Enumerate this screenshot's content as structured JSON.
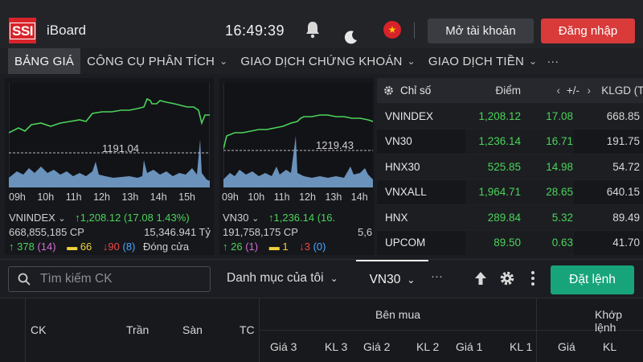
{
  "header": {
    "logo_text": "SSI",
    "app_name": "iBoard",
    "clock": "16:49:39",
    "open_account": "Mở tài khoản",
    "login": "Đăng nhập",
    "flag_symbol": "★"
  },
  "menu": {
    "items": [
      {
        "label": "BẢNG GIÁ",
        "chevron": ""
      },
      {
        "label": "CÔNG CỤ PHÂN TÍCH",
        "chevron": "⌄"
      },
      {
        "label": "GIAO DỊCH CHỨNG KHOÁN",
        "chevron": "⌄"
      },
      {
        "label": "GIAO DỊCH TIỀN",
        "chevron": "⌄"
      }
    ],
    "more": "···"
  },
  "charts": [
    {
      "ref_label": "1191.04",
      "times": [
        "09h",
        "10h",
        "11h",
        "12h",
        "13h",
        "14h",
        "15h"
      ],
      "name": "VNINDEX",
      "chevron": "⌄",
      "value_line": "↑1,208.12 (17.08 1.43%)",
      "volume": "668,855,185 CP",
      "value_total": "15,346.941 Tỷ",
      "up": "↑ 378",
      "ceil": "(14)",
      "ref": "66",
      "down": "↓90",
      "floor": "(8)",
      "status": "Đóng cửa"
    },
    {
      "ref_label": "1219.43",
      "times": [
        "09h",
        "10h",
        "11h",
        "12h",
        "13h",
        "14h"
      ],
      "name": "VN30",
      "chevron": "⌄",
      "value_line": "↑1,236.14 (16.",
      "volume": "191,758,175 CP",
      "value_total": "5,6",
      "up": "↑ 26",
      "ceil": "(1)",
      "ref": "1",
      "down": "↓3",
      "floor": "(0)",
      "status": ""
    }
  ],
  "index_table": {
    "headers": {
      "name": "Chỉ số",
      "point": "Điểm",
      "change": "+/-",
      "volume": "KLGD (Triệu)"
    },
    "rows": [
      {
        "name": "VNINDEX",
        "point": "1,208.12",
        "change": "17.08",
        "volume": "668.85"
      },
      {
        "name": "VN30",
        "point": "1,236.14",
        "change": "16.71",
        "volume": "191.75"
      },
      {
        "name": "HNX30",
        "point": "525.85",
        "change": "14.98",
        "volume": "54.72"
      },
      {
        "name": "VNXALL",
        "point": "1,964.71",
        "change": "28.65",
        "volume": "640.15"
      },
      {
        "name": "HNX",
        "point": "289.84",
        "change": "5.32",
        "volume": "89.49"
      },
      {
        "name": "UPCOM",
        "point": "89.50",
        "change": "0.63",
        "volume": "41.70"
      }
    ]
  },
  "filter": {
    "search_placeholder": "Tìm kiếm CK",
    "watchlist": "Danh mục của tôi",
    "selected_group": "VN30",
    "more": "···",
    "order_button": "Đặt lệnh"
  },
  "board": {
    "ck": "CK",
    "ceiling": "Trần",
    "floor": "Sàn",
    "ref": "TC",
    "buy_group": "Bên mua",
    "match_group": "Khớp lệnh",
    "buy_cols": [
      "Giá 3",
      "KL 3",
      "Giá 2",
      "KL 2",
      "Giá 1",
      "KL 1"
    ],
    "match_cols": [
      "Giá",
      "KL"
    ]
  },
  "colors": {
    "up_green": "#4cd35a",
    "down_red": "#f04545",
    "floor_blue": "#4aa8ff",
    "ceil_purple": "#d66bd6",
    "ref_yellow": "#f0d23c",
    "login_red": "#d93a3a",
    "order_green": "#18a47a"
  }
}
